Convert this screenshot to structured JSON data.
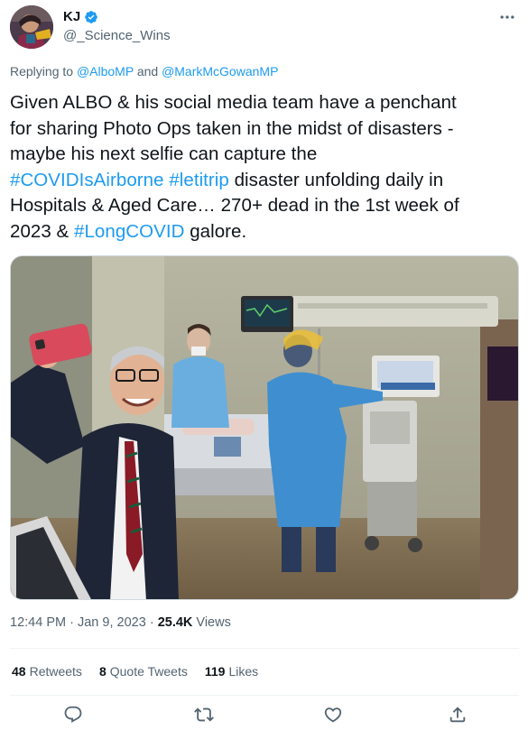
{
  "author": {
    "display_name": "KJ",
    "handle": "@_Science_Wins",
    "verified_icon": "verified-badge-icon",
    "avatar_icon": "avatar-illustration"
  },
  "more_icon": "more-options-icon",
  "reply_context": {
    "prefix": "Replying to",
    "user1": "@AlboMP",
    "joiner": "and",
    "user2": "@MarkMcGowanMP"
  },
  "tweet": {
    "line1": "Given ALBO & his social media team have a penchant",
    "line2": "for sharing Photo Ops taken in the midst of disasters -",
    "line3": "maybe his next selfie can capture the",
    "hashtag1": "#COVIDIsAirborne",
    "hashtag2": "#letitrip",
    "line4_rest": "disaster unfolding daily in",
    "line5": "Hospitals & Aged Care… 270+ dead in the 1st week of",
    "line6_pre": "2023 &",
    "hashtag3": "#LongCOVID",
    "line6_post": "galore."
  },
  "meta": {
    "time": "12:44 PM",
    "sep1": "·",
    "date": "Jan 9, 2023",
    "sep2": "·",
    "views_count": "25.4K",
    "views_label": "Views"
  },
  "stats": {
    "retweets_count": "48",
    "retweets_label": "Retweets",
    "quotes_count": "8",
    "quotes_label": "Quote Tweets",
    "likes_count": "119",
    "likes_label": "Likes"
  },
  "actions": {
    "reply_icon": "reply-icon",
    "retweet_icon": "retweet-icon",
    "like_icon": "heart-icon",
    "share_icon": "share-icon"
  },
  "colors": {
    "link": "#1d9bf0",
    "text": "#0f1419",
    "secondary": "#536471",
    "divider": "#eff3f4"
  }
}
